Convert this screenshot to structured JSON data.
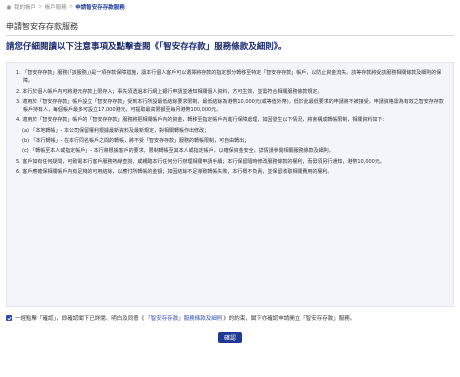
{
  "breadcrumb": {
    "items": [
      "我的帳戶",
      "帳戶服務",
      "申請智安存存款服務"
    ]
  },
  "page": {
    "title": "申請智安存存款服務",
    "notice": "請您仔細閱讀以下注意事項及點擊查閱《「智安存存款」服務條款及細則》。"
  },
  "terms": {
    "paragraphs": [
      "1. 「智安存存款」服務(「該服務」)是一項存款保障措施，讓本行個人客戶可以選擇將存款的指定部分轉移至特定「智安存存款」帳戶，以防止資金流失。該等存款將受該服務相關條款及細則的保障。",
      "2. 本行於個人帳戶內可將港元存款上限存入；事先須透過本行網上銀行申請並通知相關個人資料，方可生效，並需符合相關服務條款規定。",
      "3. 適用於「智安存存款」帳戶設立「智安存存款」受到本行所設最低結餘要求限制，最低結餘為港幣10,000元(或等值外幣)，低於此最低要求的申請將不被接受。申請資格需為有效之智安存存款帳戶持有人，每個帳戶最多可設立17,000港元，可提取最高限額至每月港幣100,000元。",
      "4. 適用於「智安存存款」帳戶的「智安存存款」服務將把相關帳戶內的資金，轉移至指定帳戶內進行保障處理，如因發生以下情況，將會構成轉帳限制，相關資料如下：",
      "(a) 「本地轉帳」- 本公司保留權利根據最新資料及最新規定，對相關轉帳作出修改；",
      "(b) 「本行轉帳」- 在本行同名帳戶之間的轉帳，將不受「智安存存款」服務的轉帳限制，可自由轉出；",
      "(c) 「轉帳至本人或指定帳戶」- 本行將根據客戶的要求，限制轉帳至其本人或指定帳戶，以確保資金安全，詳情請參閱相關服務條款及細則。",
      "5. 客戶如有任何疑問，可致電本行客戶服務熱線查詢，或親臨本行任何分行辦理相關申請手續；本行保留隨時修改服務條款的權利，而毋須另行通知，港幣10,000元。",
      "6. 客戶應確保相關帳戶內有足夠的可用結餘，以應付所轉帳的金額；如因結餘不足導致轉帳失敗，本行概不負責，並保留收取相關費用的權利。"
    ]
  },
  "agreement": {
    "prefix": "一經點擊「確認」，即確認閣下已詳閱、明白及同意《",
    "link": "「智安存存款」服務條款及細則",
    "suffix": "》的約束，閣下亦確認申請開立「智安存存款」服務。"
  },
  "confirm_label": "確認"
}
